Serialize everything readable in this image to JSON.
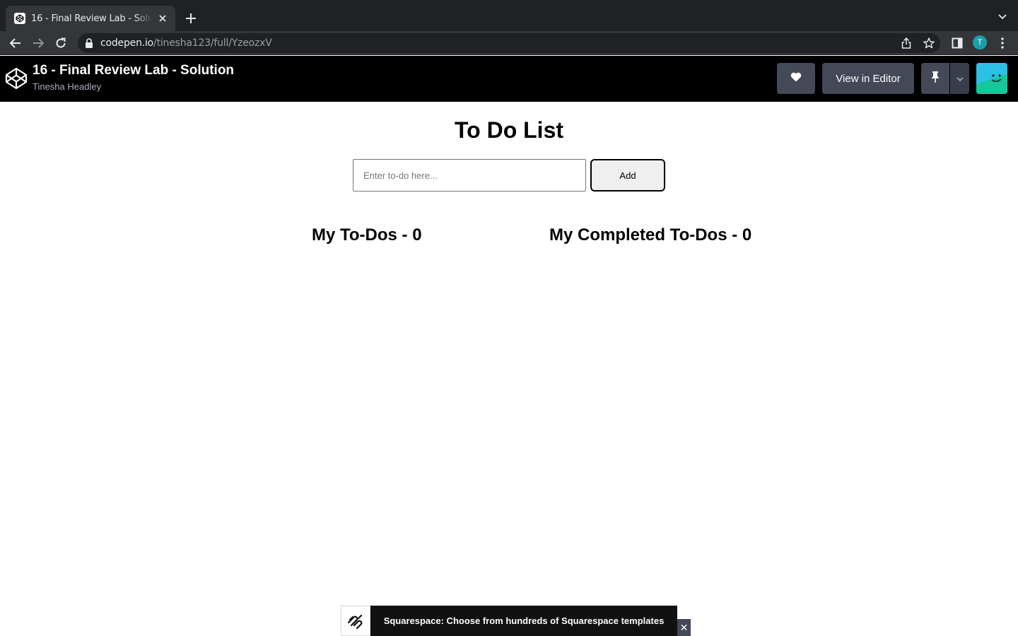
{
  "browser": {
    "tab_title": "16 - Final Review Lab - Solution",
    "url_host": "codepen.io",
    "url_path": "/tinesha123/full/YzeozxV",
    "profile_initial": "T"
  },
  "codepen": {
    "pen_title": "16 - Final Review Lab - Solution",
    "author": "Tinesha Headley",
    "view_in_editor_label": "View in Editor"
  },
  "app": {
    "title": "To Do List",
    "input_placeholder": "Enter to-do here...",
    "input_value": "",
    "add_label": "Add",
    "todos_heading": "My To-Dos - 0",
    "completed_heading": "My Completed To-Dos - 0"
  },
  "ad": {
    "text": "Squarespace: Choose from hundreds of Squarespace templates",
    "close_label": "✕"
  },
  "colors": {
    "chrome_dark": "#202124",
    "chrome_toolbar": "#35363a",
    "codepen_header": "#000000",
    "codepen_button": "#444857"
  }
}
